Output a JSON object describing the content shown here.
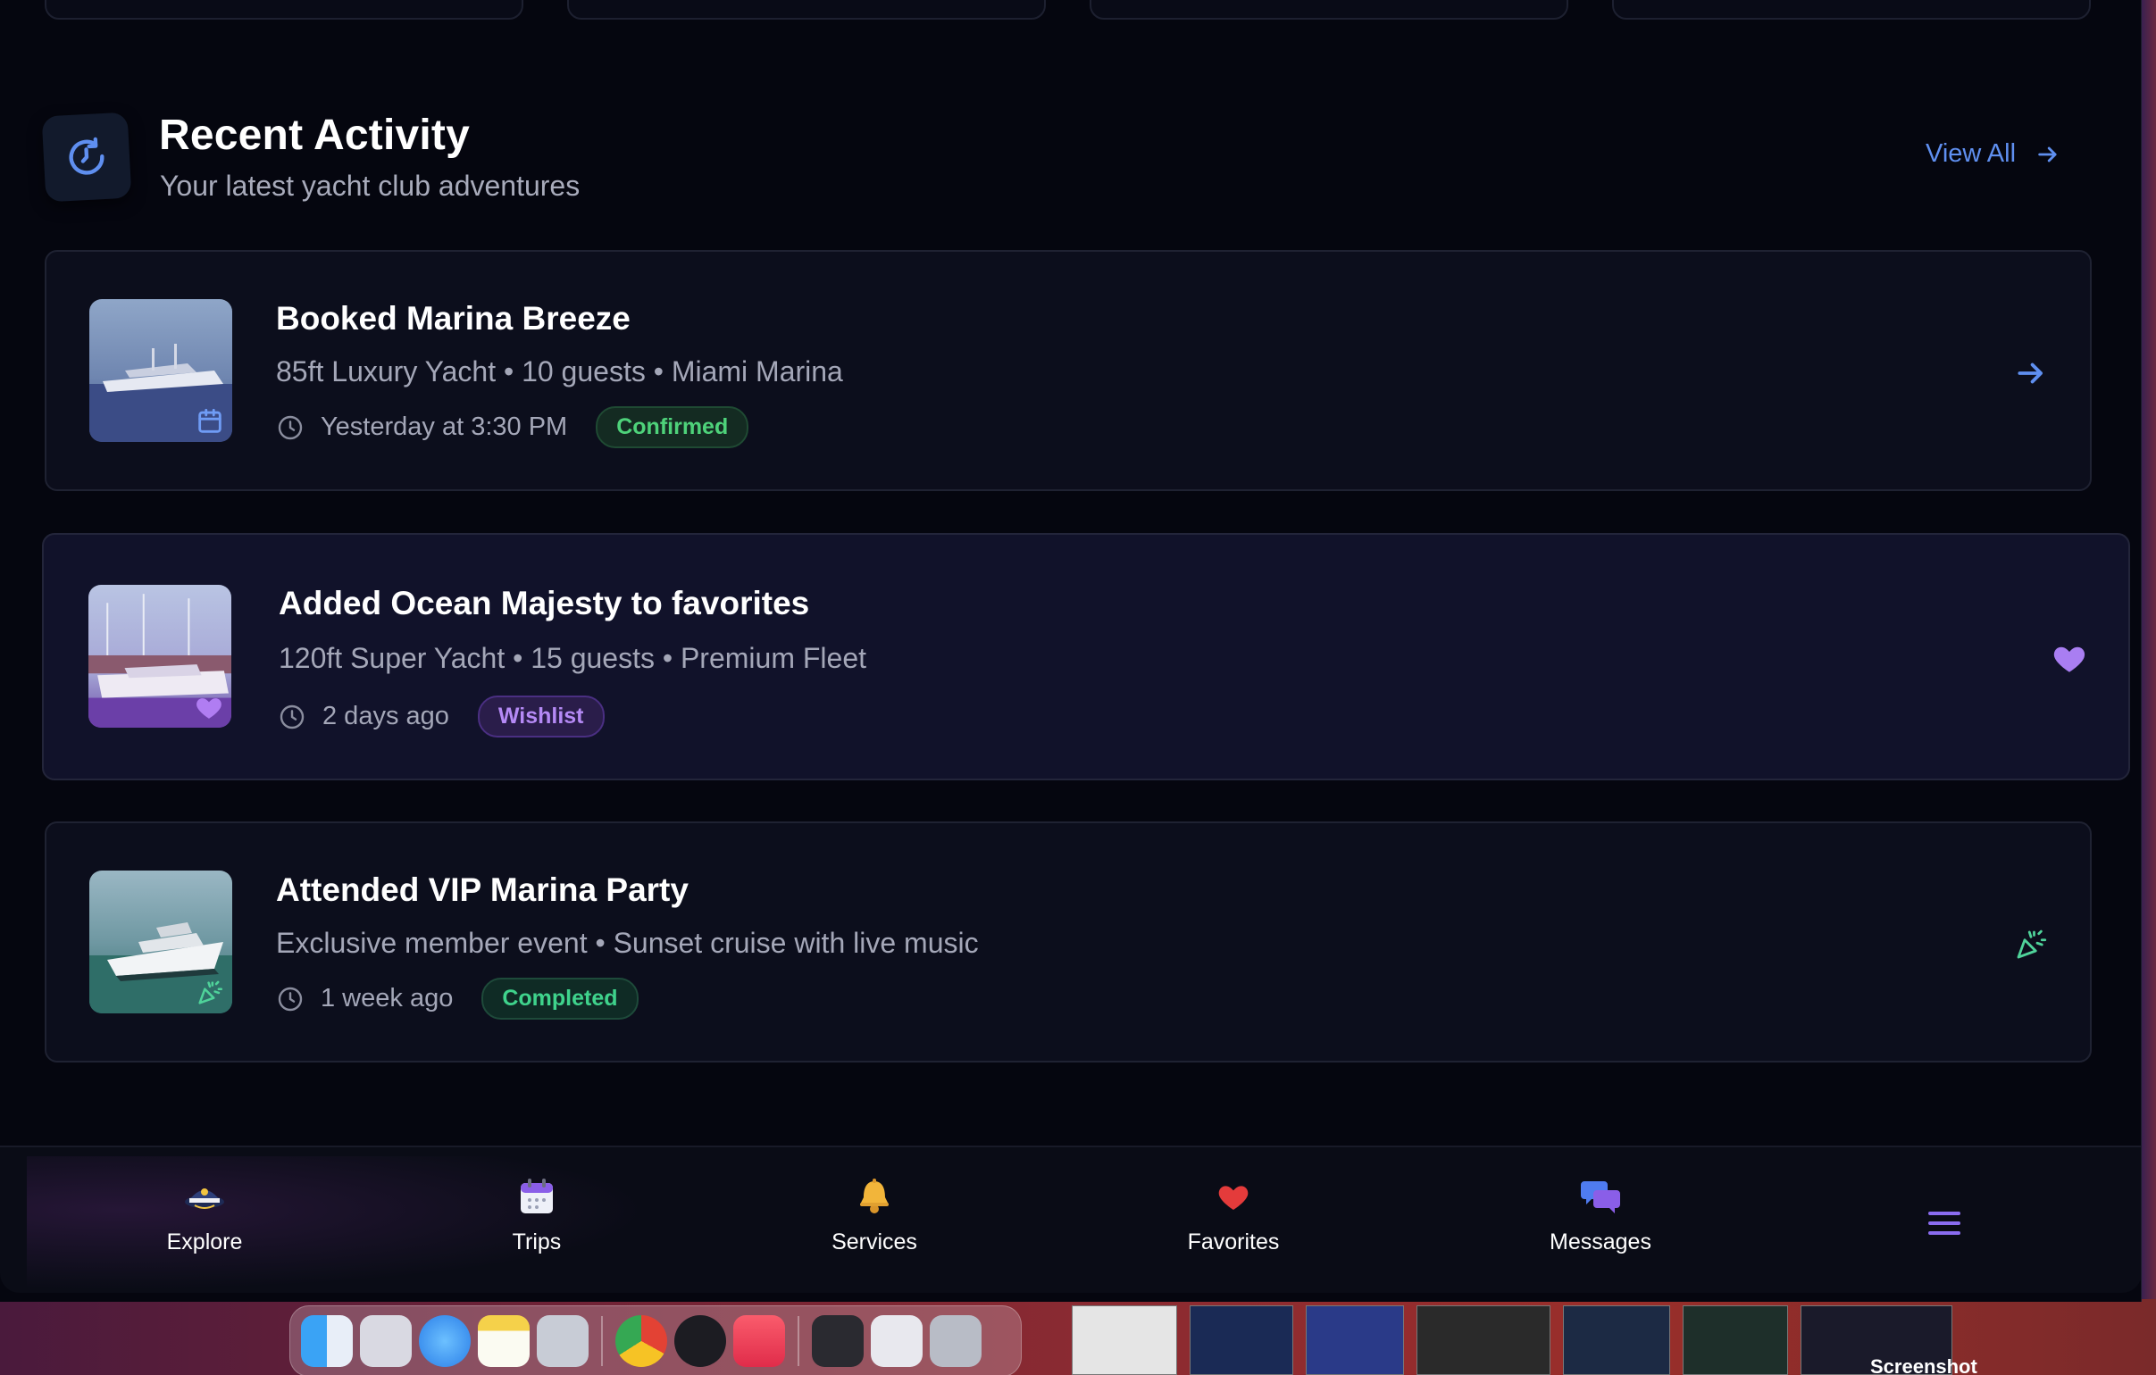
{
  "section": {
    "title": "Recent Activity",
    "subtitle": "Your latest yacht club adventures",
    "view_all": "View All"
  },
  "activities": [
    {
      "title": "Booked Marina Breeze",
      "details": "85ft Luxury Yacht • 10 guests • Miami Marina",
      "time": "Yesterday at 3:30 PM",
      "status": "Confirmed",
      "thumb_icon": "calendar-icon",
      "action_icon": "arrow-right-icon"
    },
    {
      "title": "Added Ocean Majesty to favorites",
      "details": "120ft Super Yacht • 15 guests • Premium Fleet",
      "time": "2 days ago",
      "status": "Wishlist",
      "thumb_icon": "heart-icon",
      "action_icon": "heart-icon"
    },
    {
      "title": "Attended VIP Marina Party",
      "details": "Exclusive member event • Sunset cruise with live music",
      "time": "1 week ago",
      "status": "Completed",
      "thumb_icon": "party-popper-icon",
      "action_icon": "party-popper-icon"
    }
  ],
  "nav": {
    "items": [
      {
        "label": "Explore",
        "icon": "captain-hat-icon"
      },
      {
        "label": "Trips",
        "icon": "calendar-icon"
      },
      {
        "label": "Services",
        "icon": "bell-icon"
      },
      {
        "label": "Favorites",
        "icon": "heart-icon"
      },
      {
        "label": "Messages",
        "icon": "chat-bubbles-icon"
      }
    ],
    "menu_icon": "hamburger-menu-icon"
  },
  "dock": {
    "screenshot_label": "Screenshot"
  },
  "colors": {
    "background": "#05060f",
    "accent_blue": "#5f8ff0",
    "confirmed": "#4ed27a",
    "wishlist": "#b58af5",
    "completed": "#3fd38c"
  }
}
